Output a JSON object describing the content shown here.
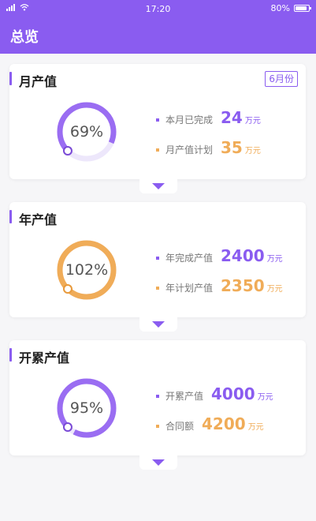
{
  "status": {
    "time": "17:20",
    "battery": "80%"
  },
  "appbar": {
    "title": "总览"
  },
  "cards": [
    {
      "title": "月产值",
      "month": "6月份",
      "percent": "69%",
      "percent_value": 0.69,
      "ring_color": "#9a6df2",
      "stats": [
        {
          "label": "本月已完成",
          "value": "24",
          "unit": "万元"
        },
        {
          "label": "月产值计划",
          "value": "35",
          "unit": "万元"
        }
      ]
    },
    {
      "title": "年产值",
      "percent": "102%",
      "percent_value": 1.02,
      "ring_color": "#f0ac58",
      "stats": [
        {
          "label": "年完成产值",
          "value": "2400",
          "unit": "万元"
        },
        {
          "label": "年计划产值",
          "value": "2350",
          "unit": "万元"
        }
      ]
    },
    {
      "title": "开累产值",
      "percent": "95%",
      "percent_value": 0.95,
      "ring_color": "#9a6df2",
      "stats": [
        {
          "label": "开累产值",
          "value": "4000",
          "unit": "万元"
        },
        {
          "label": "合同额",
          "value": "4200",
          "unit": "万元"
        }
      ]
    }
  ],
  "colors": {
    "primary": "#8a5cf0",
    "secondary": "#f0ac58"
  }
}
